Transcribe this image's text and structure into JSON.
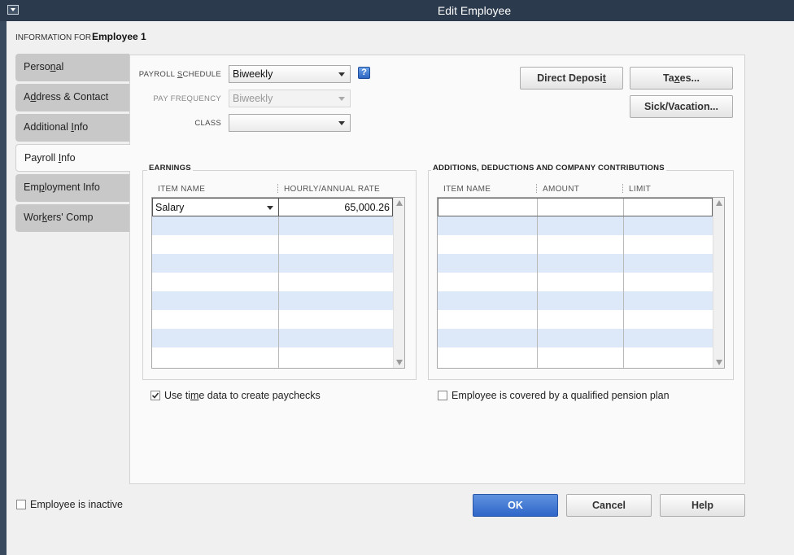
{
  "window": {
    "title": "Edit Employee"
  },
  "header": {
    "info_for_label": "INFORMATION FOR",
    "employee_name": "Employee 1"
  },
  "tabs": [
    {
      "pre": "Perso",
      "mn": "n",
      "post": "al",
      "active": false
    },
    {
      "pre": "A",
      "mn": "d",
      "post": "dress & Contact",
      "active": false
    },
    {
      "pre": "Additional ",
      "mn": "I",
      "post": "nfo",
      "active": false
    },
    {
      "pre": "Payroll ",
      "mn": "I",
      "post": "nfo",
      "active": true
    },
    {
      "pre": "Em",
      "mn": "p",
      "post": "loyment Info",
      "active": false
    },
    {
      "pre": "Wor",
      "mn": "k",
      "post": "ers' Comp",
      "active": false
    }
  ],
  "payroll": {
    "schedule_label_pre": "PAYROLL ",
    "schedule_label_mn": "S",
    "schedule_label_post": "CHEDULE",
    "schedule_value": "Biweekly",
    "frequency_label": "PAY FREQUENCY",
    "frequency_value": "Biweekly",
    "class_label": "CLASS",
    "class_value": "",
    "help_icon_text": "?"
  },
  "buttons": {
    "direct_deposit_pre": "Direct Deposi",
    "direct_deposit_mn": "t",
    "direct_deposit_post": "",
    "taxes_pre": "Ta",
    "taxes_mn": "x",
    "taxes_post": "es...",
    "sick_vacation": "Sick/Vacation...",
    "ok": "OK",
    "cancel": "Cancel",
    "help": "Help"
  },
  "earnings": {
    "title": "EARNINGS",
    "columns": [
      "ITEM NAME",
      "HOURLY/ANNUAL RATE"
    ],
    "rows": [
      {
        "item": "Salary",
        "rate": "65,000.26"
      }
    ]
  },
  "additions": {
    "title": "ADDITIONS, DEDUCTIONS AND COMPANY CONTRIBUTIONS",
    "columns": [
      "ITEM NAME",
      "AMOUNT",
      "LIMIT"
    ]
  },
  "checkboxes": {
    "use_time_pre": "Use ti",
    "use_time_mn": "m",
    "use_time_post": "e data to create paychecks",
    "use_time_checked": true,
    "pension": "Employee is covered by a qualified pension plan",
    "pension_checked": false,
    "inactive": "Employee is inactive",
    "inactive_checked": false
  },
  "colors": {
    "titlebar": "#2b3a4d",
    "grid_alt_row": "#dde9f8",
    "primary_button": "#2f66c8"
  }
}
